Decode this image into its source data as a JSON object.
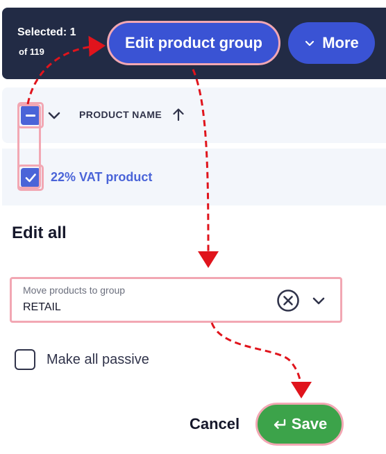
{
  "selection_bar": {
    "selected_label": "Selected: 1",
    "of_label": "of 119",
    "edit_group_button": "Edit product group",
    "more_button": "More"
  },
  "table": {
    "column_header": "PRODUCT NAME",
    "rows": [
      {
        "name": "22% VAT product",
        "checked": true
      }
    ]
  },
  "edit_all": {
    "title": "Edit all",
    "group_field": {
      "label": "Move products to group",
      "value": "RETAIL"
    },
    "passive_checkbox": {
      "label": "Make all passive",
      "checked": false
    }
  },
  "actions": {
    "cancel": "Cancel",
    "save": "Save"
  },
  "icons": {
    "header_checkbox": "indeterminate-checkbox-icon",
    "row_checkbox": "check-icon",
    "sort": "arrow-up-icon",
    "clear": "clear-circle-icon",
    "chevron": "chevron-down-icon",
    "save": "enter-return-icon"
  },
  "colors": {
    "topbar_bg": "#222b45",
    "primary": "#3a53d4",
    "checkbox_blue": "#4a64d8",
    "save_green": "#3ca34a",
    "highlight_border": "#f2a7b3",
    "annotation_arrow": "#e0141c"
  }
}
